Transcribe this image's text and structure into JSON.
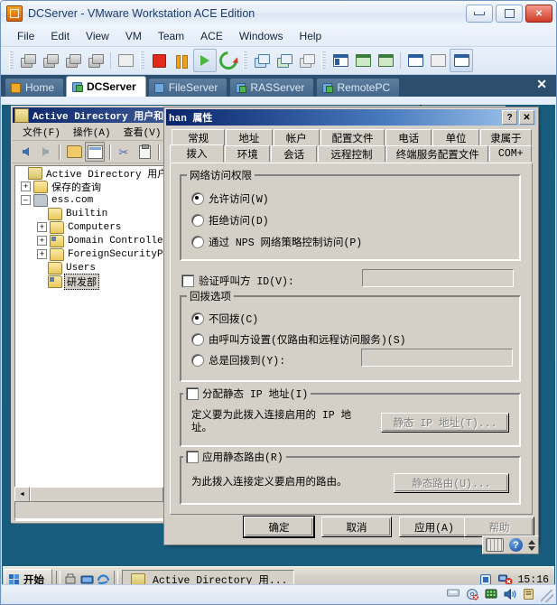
{
  "vmware": {
    "title": "DCServer - VMware Workstation ACE Edition",
    "window_controls": {
      "minimize": "–",
      "maximize": "□",
      "close": "✕"
    },
    "menu": [
      "File",
      "Edit",
      "View",
      "VM",
      "Team",
      "ACE",
      "Windows",
      "Help"
    ],
    "toolbar_icons": [
      "power-on-snapshot-icon",
      "revert-snapshot-icon",
      "snapshot-manager-icon",
      "delete-snapshot-icon",
      "capture-screen-icon",
      "power-off-icon",
      "suspend-icon",
      "power-on-icon",
      "reset-icon",
      "take-snapshot-icon",
      "revert-icon",
      "manage-snapshots-icon",
      "show-sidebar-icon",
      "fullscreen-icon",
      "quick-switch-icon",
      "vm-settings-icon",
      "summary-view-icon",
      "console-view-icon"
    ],
    "tabs": [
      {
        "label": "Home",
        "icon": "home-tab-icon",
        "selected": false
      },
      {
        "label": "DCServer",
        "icon": "vm-tab-icon",
        "selected": true
      },
      {
        "label": "FileServer",
        "icon": "vm-tab-icon",
        "selected": false
      },
      {
        "label": "RASServer",
        "icon": "vm-tab-icon",
        "selected": false
      },
      {
        "label": "RemotePC",
        "icon": "vm-tab-icon",
        "selected": false
      }
    ],
    "tab_close": "✕"
  },
  "ad_window": {
    "title": "Active Directory 用户和计算机",
    "buttons": {
      "minimize": "_",
      "maximize": "□",
      "close": "✕"
    },
    "menu": [
      "文件(F)",
      "操作(A)",
      "查看(V)"
    ],
    "toolbar_icons": [
      "back-icon",
      "forward-icon",
      "up-folder-icon",
      "show-hide-console-tree-icon",
      "cut-icon",
      "paste-icon"
    ],
    "tree": [
      {
        "label": "Active Directory 用户和计",
        "indent": 0,
        "expander": "",
        "icon": "console-root-icon",
        "selected": false
      },
      {
        "label": "保存的查询",
        "indent": 1,
        "expander": "+",
        "icon": "folder-icon",
        "selected": false
      },
      {
        "label": "ess.com",
        "indent": 1,
        "expander": "–",
        "icon": "domain-icon",
        "selected": false
      },
      {
        "label": "Builtin",
        "indent": 2,
        "expander": "",
        "icon": "folder-icon",
        "selected": false
      },
      {
        "label": "Computers",
        "indent": 2,
        "expander": "+",
        "icon": "folder-icon",
        "selected": false
      },
      {
        "label": "Domain Controller",
        "indent": 2,
        "expander": "+",
        "icon": "ou-icon",
        "selected": false
      },
      {
        "label": "ForeignSecurityPr",
        "indent": 2,
        "expander": "+",
        "icon": "folder-icon",
        "selected": false
      },
      {
        "label": "Users",
        "indent": 2,
        "expander": "",
        "icon": "folder-icon",
        "selected": false
      },
      {
        "label": "研发部",
        "indent": 2,
        "expander": "",
        "icon": "ou-icon",
        "selected": true
      }
    ],
    "hscroll": {
      "left_arrow": "◄"
    }
  },
  "dialog": {
    "title": "han 属性",
    "title_buttons": {
      "help": "?",
      "close": "✕"
    },
    "tabs_row1": [
      "常规",
      "地址",
      "帐户",
      "配置文件",
      "电话",
      "单位",
      "隶属于"
    ],
    "tabs_row2": [
      "拨入",
      "环境",
      "会话",
      "远程控制",
      "终端服务配置文件",
      "COM+"
    ],
    "selected_tab": "拨入",
    "network_access": {
      "legend": "网络访问权限",
      "options": [
        {
          "label": "允许访问(W)",
          "checked": true
        },
        {
          "label": "拒绝访问(D)",
          "checked": false
        },
        {
          "label": "通过 NPS 网络策略控制访问(P)",
          "checked": false
        }
      ]
    },
    "verify_caller_id": {
      "label": "验证呼叫方 ID(V):",
      "checked": false,
      "value": ""
    },
    "callback": {
      "legend": "回拨选项",
      "options": [
        {
          "label": "不回拨(C)",
          "checked": true
        },
        {
          "label": "由呼叫方设置(仅路由和远程访问服务)(S)",
          "checked": false
        },
        {
          "label": "总是回拨到(Y):",
          "checked": false
        }
      ],
      "callback_number": ""
    },
    "static_ip": {
      "legend": "分配静态 IP 地址(I)",
      "checked": false,
      "description": "定义要为此拨入连接启用的 IP 地址。",
      "button": "静态 IP 地址(T)..."
    },
    "static_routes": {
      "legend": "应用静态路由(R)",
      "checked": false,
      "description": "为此拨入连接定义要启用的路由。",
      "button": "静态路由(U)..."
    },
    "buttons": {
      "ok": "确定",
      "cancel": "取消",
      "apply": "应用(A)",
      "help": "帮助"
    }
  },
  "taskbar": {
    "start": "开始",
    "quick_launch": [
      "show-desktop-icon",
      "network-icon",
      "internet-explorer-icon"
    ],
    "items": [
      {
        "label": "Active Directory 用...",
        "icon": "mmc-icon"
      }
    ],
    "tray_icons": [
      "vmware-tools-icon",
      "network-disconnected-icon"
    ],
    "clock": "15:16"
  },
  "vm_statusbar": {
    "icons": [
      "floppy-icon",
      "cdrom-icon",
      "network-icon",
      "sound-icon",
      "usb-icon"
    ]
  },
  "floating": {
    "keyboard_icon": "keyboard-icon",
    "help_icon": "help-icon",
    "spinner_icon": "spinner-icon"
  }
}
